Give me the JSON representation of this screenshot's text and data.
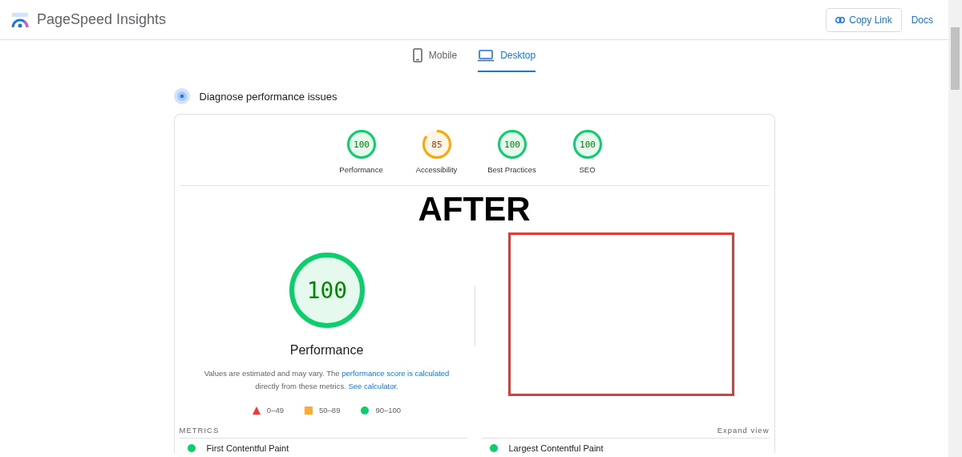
{
  "header": {
    "title": "PageSpeed Insights",
    "buttons": [
      {
        "kind": "outlined",
        "label": "Copy Link"
      },
      {
        "kind": "text",
        "label": "Docs"
      }
    ]
  },
  "tabs": [
    {
      "kind": "mobile",
      "label": "Mobile",
      "selected": false
    },
    {
      "kind": "desktop",
      "label": "Desktop",
      "selected": true
    }
  ],
  "section_title": "Diagnose performance issues",
  "categories": [
    {
      "score": "100",
      "label": "Performance"
    },
    {
      "score": "85",
      "label": "Accessibility"
    },
    {
      "score": "100",
      "label": "Best Practices"
    },
    {
      "score": "100",
      "label": "SEO"
    }
  ],
  "overlay_text": "AFTER",
  "main_score": {
    "score": "100",
    "label": "Performance"
  },
  "description": "Values are estimated and may vary. The ",
  "description_link": "performance score is calculated",
  "description_2": " directly from these metrics. ",
  "description_link_2": "See calculator.",
  "legend": [
    {
      "kind": "triangle",
      "label": "0–49",
      "color": "#ff3333"
    },
    {
      "kind": "square",
      "label": "50–89",
      "color": "#ffaa33"
    },
    {
      "kind": "circle",
      "label": "90–100",
      "color": "#0cce6b"
    }
  ],
  "metrics_heading": "METRICS",
  "expand": "Expand view",
  "metrics": [
    {
      "label": "First Contentful Paint",
      "color": "#0cce6b"
    },
    {
      "label": "Largest Contentful Paint",
      "color": "#0cce6b"
    }
  ]
}
